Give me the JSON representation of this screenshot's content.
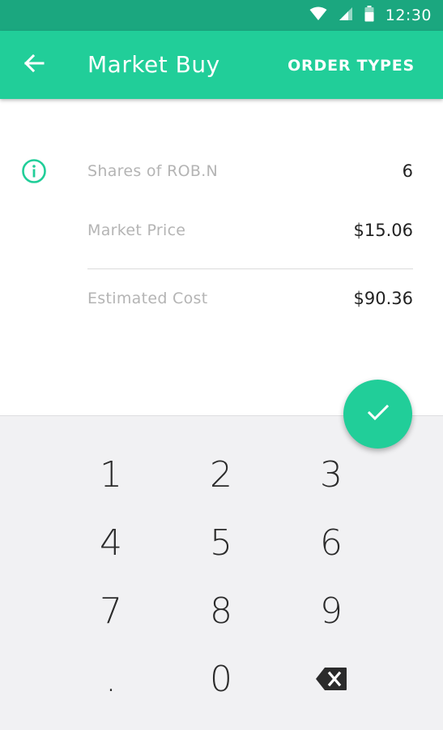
{
  "status_bar": {
    "time": "12:30",
    "icons": [
      "wifi-icon",
      "cell-signal-icon",
      "battery-icon"
    ]
  },
  "app_bar": {
    "back_icon": "arrow-left-icon",
    "title": "Market Buy",
    "action_label": "ORDER TYPES"
  },
  "order": {
    "info_icon": "info-circle-icon",
    "shares_label": "Shares of ROB.N",
    "shares_value": "6",
    "price_label": "Market Price",
    "price_value": "$15.06",
    "cost_label": "Estimated Cost",
    "cost_value": "$90.36"
  },
  "fab": {
    "icon": "checkmark-icon"
  },
  "keypad": {
    "keys": [
      "1",
      "2",
      "3",
      "4",
      "5",
      "6",
      "7",
      "8",
      "9",
      ".",
      "0"
    ],
    "backspace_icon": "backspace-icon"
  },
  "colors": {
    "status_bar": "#1ba77f",
    "accent": "#21ce99",
    "keypad_bg": "#f1f1f3",
    "label_text": "#b4b4b4",
    "value_text": "#222222"
  }
}
